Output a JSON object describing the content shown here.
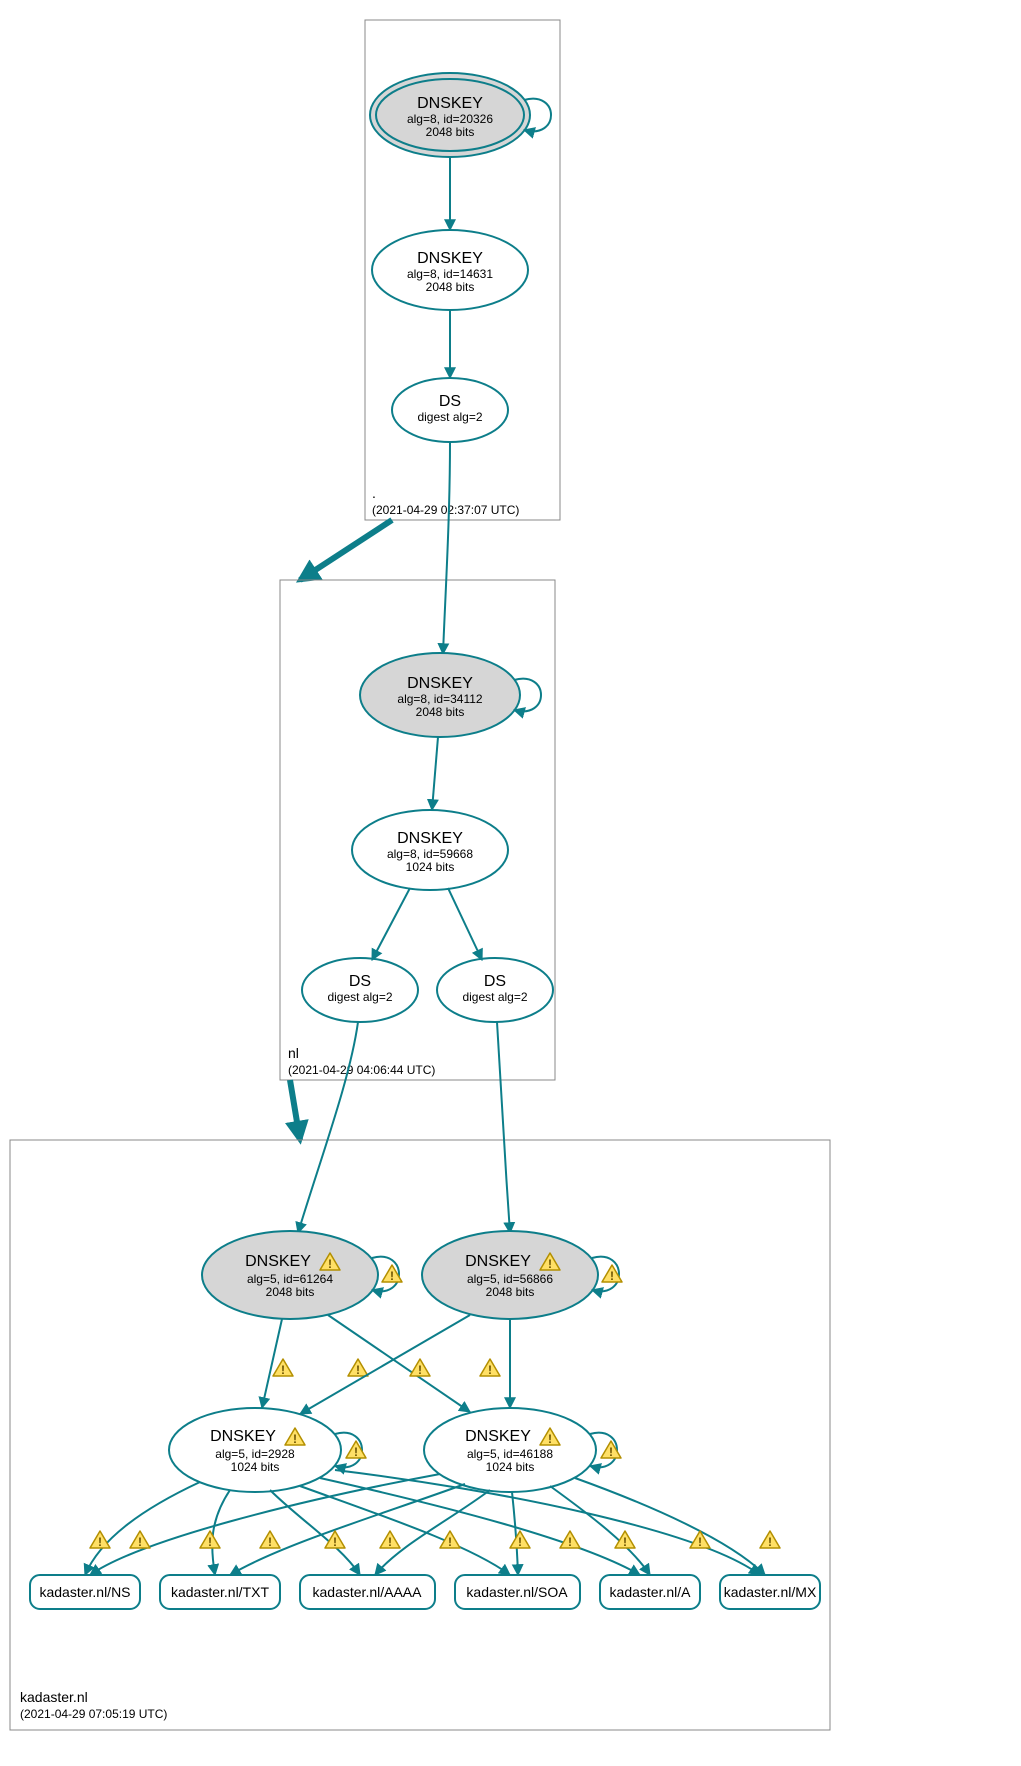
{
  "zones": {
    "root": {
      "name": ".",
      "timestamp": "(2021-04-29 02:37:07 UTC)"
    },
    "nl": {
      "name": "nl",
      "timestamp": "(2021-04-29 04:06:44 UTC)"
    },
    "kad": {
      "name": "kadaster.nl",
      "timestamp": "(2021-04-29 07:05:19 UTC)"
    }
  },
  "nodes": {
    "root_ksk": {
      "title": "DNSKEY",
      "l1": "alg=8, id=20326",
      "l2": "2048 bits"
    },
    "root_zsk": {
      "title": "DNSKEY",
      "l1": "alg=8, id=14631",
      "l2": "2048 bits"
    },
    "root_ds": {
      "title": "DS",
      "l1": "digest alg=2"
    },
    "nl_ksk": {
      "title": "DNSKEY",
      "l1": "alg=8, id=34112",
      "l2": "2048 bits"
    },
    "nl_zsk": {
      "title": "DNSKEY",
      "l1": "alg=8, id=59668",
      "l2": "1024 bits"
    },
    "nl_ds1": {
      "title": "DS",
      "l1": "digest alg=2"
    },
    "nl_ds2": {
      "title": "DS",
      "l1": "digest alg=2"
    },
    "kad_ksk1": {
      "title": "DNSKEY",
      "l1": "alg=5, id=61264",
      "l2": "2048 bits"
    },
    "kad_ksk2": {
      "title": "DNSKEY",
      "l1": "alg=5, id=56866",
      "l2": "2048 bits"
    },
    "kad_zsk1": {
      "title": "DNSKEY",
      "l1": "alg=5, id=2928",
      "l2": "1024 bits"
    },
    "kad_zsk2": {
      "title": "DNSKEY",
      "l1": "alg=5, id=46188",
      "l2": "1024 bits"
    }
  },
  "rrsets": {
    "ns": "kadaster.nl/NS",
    "txt": "kadaster.nl/TXT",
    "aaaa": "kadaster.nl/AAAA",
    "soa": "kadaster.nl/SOA",
    "a": "kadaster.nl/A",
    "mx": "kadaster.nl/MX"
  }
}
